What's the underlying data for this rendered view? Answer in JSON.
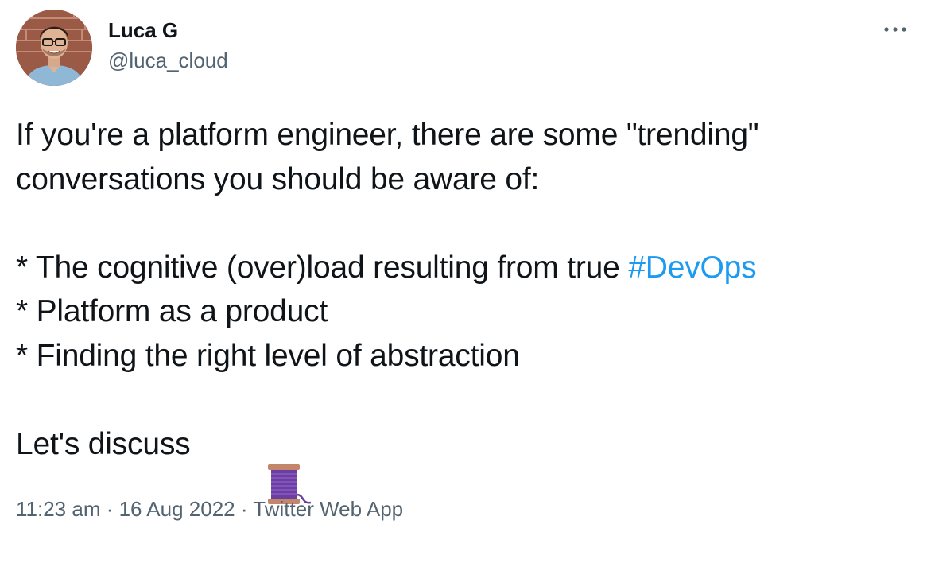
{
  "author": {
    "display_name": "Luca G",
    "handle": "@luca_cloud"
  },
  "icons": {
    "more": "more-horizontal-icon",
    "thread": "spool-of-thread-icon"
  },
  "tweet": {
    "line1": "If you're a platform engineer, there are some \"trending\"",
    "line2": "conversations you should be aware of:",
    "bullet1_prefix": "* The cognitive (over)load resulting from true ",
    "bullet1_hashtag": "#DevOps",
    "bullet2": "* Platform as a product",
    "bullet3": "* Finding the right level of abstraction",
    "closing": "Let's discuss"
  },
  "meta": {
    "time": "11:23 am",
    "separator": " · ",
    "date": "16 Aug 2022",
    "source": "Twitter Web App"
  },
  "colors": {
    "text": "#0f1419",
    "secondary": "#536471",
    "link": "#1d9bf0"
  }
}
